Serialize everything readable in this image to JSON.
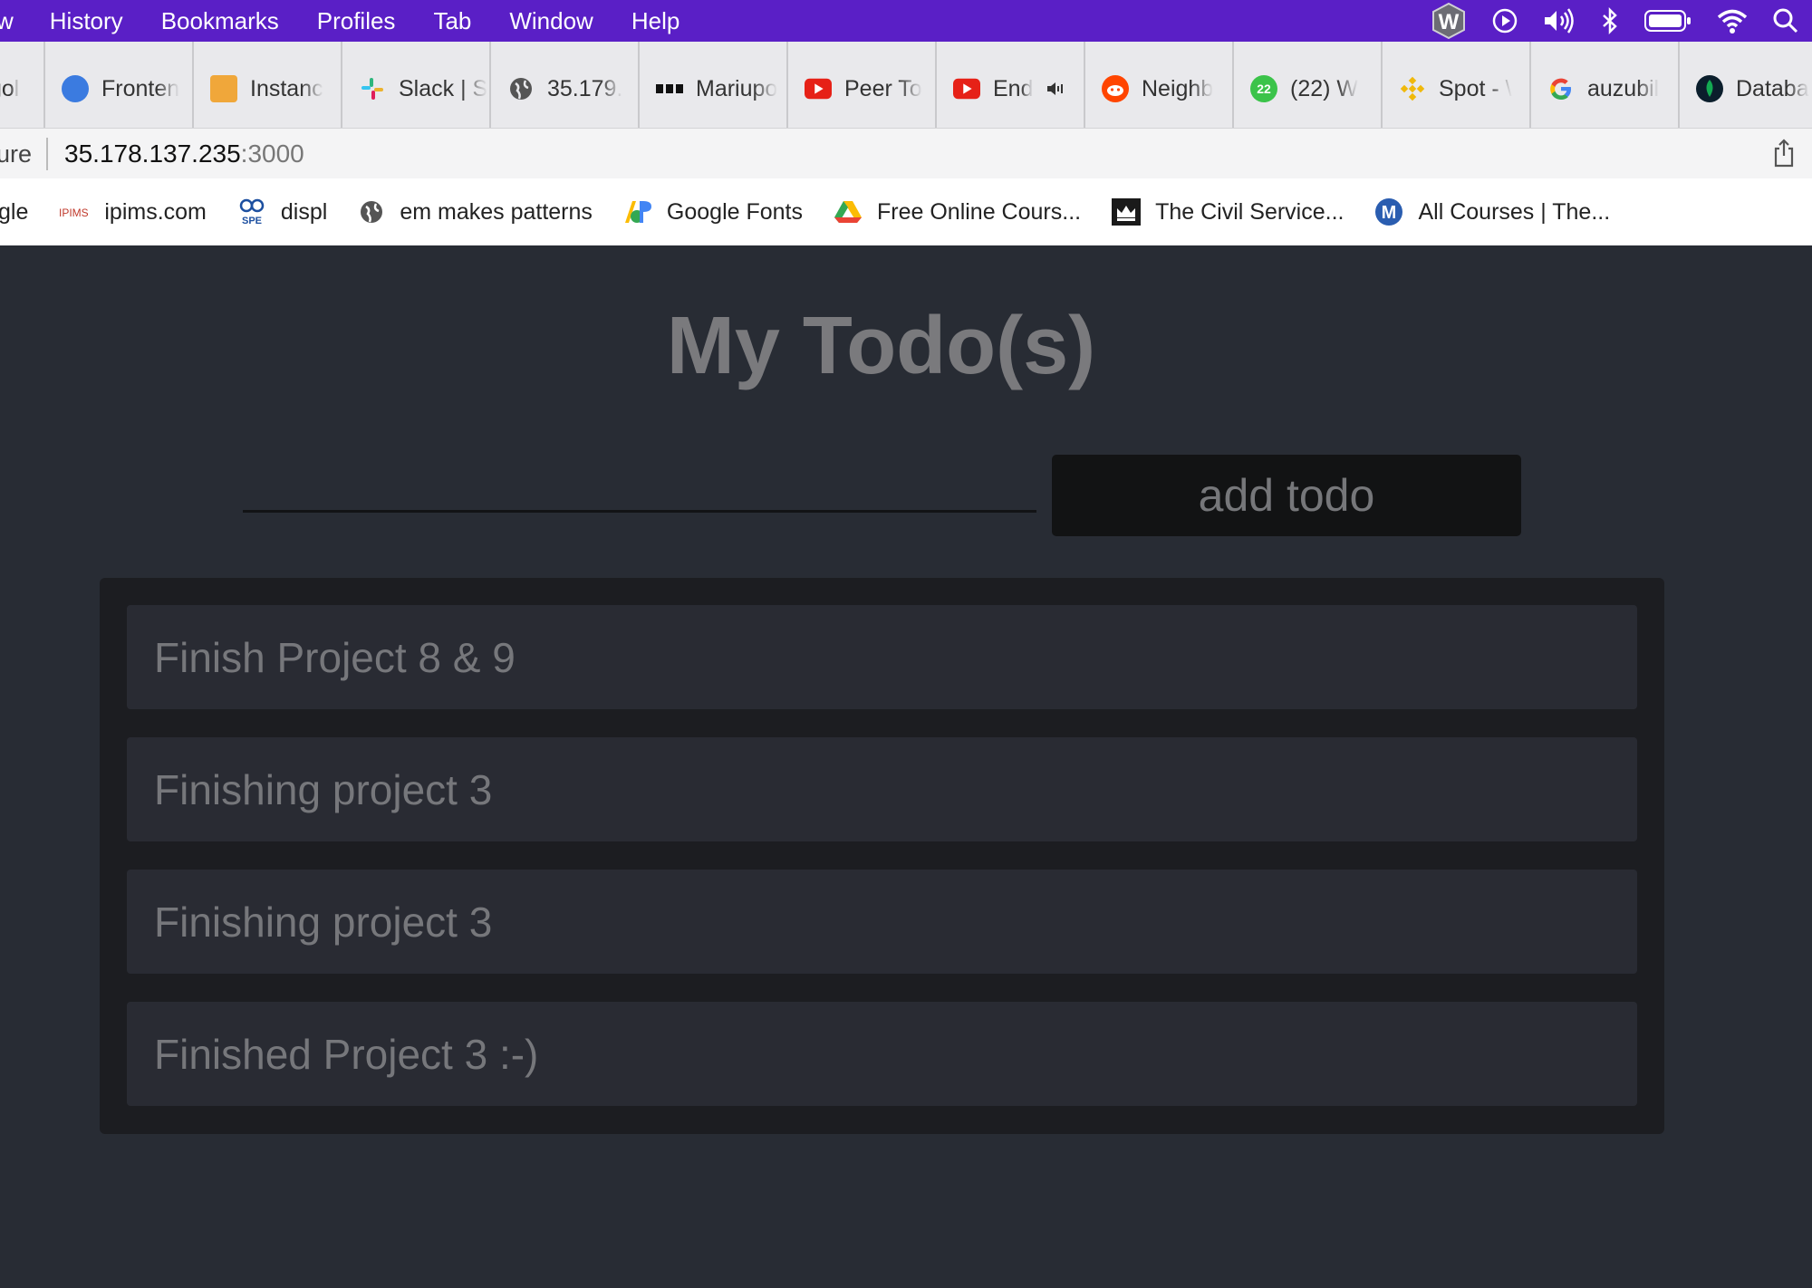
{
  "menubar": {
    "items": [
      "w",
      "History",
      "Bookmarks",
      "Profiles",
      "Tab",
      "Window",
      "Help"
    ],
    "status_icons": [
      "w-app-icon",
      "play-icon",
      "volume-icon",
      "bluetooth-icon",
      "battery-icon",
      "wifi-icon",
      "search-icon"
    ],
    "bg_color": "#5a1fc6"
  },
  "tabs": [
    {
      "label": "gol",
      "icon": "google-icon"
    },
    {
      "label": "Fronten",
      "icon": "frontend-icon"
    },
    {
      "label": "Instanc",
      "icon": "aws-box-icon"
    },
    {
      "label": "Slack | S",
      "icon": "slack-icon"
    },
    {
      "label": "35.179.",
      "icon": "globe-icon"
    },
    {
      "label": "Mariupo",
      "icon": "medium-icon"
    },
    {
      "label": "Peer To",
      "icon": "youtube-icon"
    },
    {
      "label": "End",
      "icon": "youtube-icon",
      "audio": true
    },
    {
      "label": "Neighb",
      "icon": "reddit-icon"
    },
    {
      "label": "(22) W",
      "icon": "whatsapp-icon",
      "badge": "22"
    },
    {
      "label": "Spot - \\",
      "icon": "binance-icon"
    },
    {
      "label": "auzubil",
      "icon": "google-g-icon"
    },
    {
      "label": "Databa",
      "icon": "mongodb-leaf-icon"
    }
  ],
  "address": {
    "secure_text": "ure",
    "host": "35.178.137.235",
    "port": ":3000"
  },
  "bookmarks": [
    {
      "label": "gle",
      "icon": ""
    },
    {
      "label": "ipims.com",
      "icon": "ipims-icon"
    },
    {
      "label": "displ",
      "icon": "spe-icon"
    },
    {
      "label": "em makes patterns",
      "icon": "globe-icon"
    },
    {
      "label": "Google Fonts",
      "icon": "google-fonts-icon"
    },
    {
      "label": "Free Online Cours...",
      "icon": "drive-icon"
    },
    {
      "label": "The Civil Service...",
      "icon": "crown-icon"
    },
    {
      "label": "All Courses | The...",
      "icon": "m-logo-icon"
    }
  ],
  "page": {
    "title": "My Todo(s)",
    "input_value": "",
    "add_button": "add todo",
    "todos": [
      "Finish Project 8 & 9",
      "Finishing project 3",
      "Finishing project 3",
      "Finished Project 3 :-)"
    ]
  }
}
